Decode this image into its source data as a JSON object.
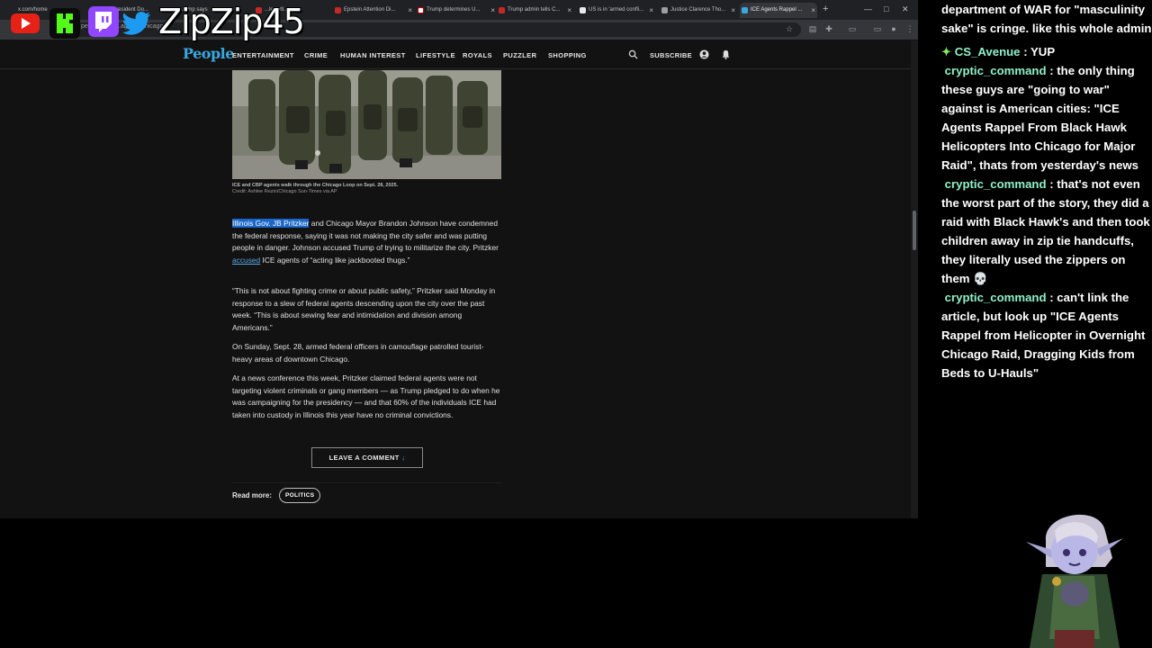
{
  "overlay": {
    "streamer_name": "ZipZip45",
    "badges": [
      "youtube-icon",
      "kick-icon",
      "twitch-icon",
      "twitter-icon"
    ]
  },
  "browser": {
    "tabs": [
      {
        "label": "x.com/home"
      },
      {
        "label": "Vice President Do..."
      },
      {
        "label": "...ump says"
      },
      {
        "label": "...legedl..."
      },
      {
        "label": "Epstein Attention Di..."
      },
      {
        "label": "Trump determines U..."
      },
      {
        "label": "Trump admin tells C..."
      },
      {
        "label": "US is in 'armed confli..."
      },
      {
        "label": "Justice Clarence Tho..."
      },
      {
        "label": "ICE Agents Rappel ..."
      }
    ],
    "url": "people.com/...agents-chicago..."
  },
  "site": {
    "logo": "People",
    "nav": [
      "ENTERTAINMENT",
      "CRIME",
      "HUMAN INTEREST",
      "LIFESTYLE",
      "ROYALS",
      "PUZZLER",
      "SHOPPING"
    ],
    "subscribe": "SUBSCRIBE"
  },
  "article": {
    "caption": "ICE and CBP agents walk through the Chicago Loop on Sept. 28, 2025.",
    "credit": "Credit: Ashlee Rezin/Chicago Sun-Times via AP",
    "p1_hl": "Illinois Gov. JB Pritzker",
    "p1_a": " and Chicago Mayor Brandon Johnson have condemned the federal response, saying it was not making the city safer and was putting people in danger. Johnson accused Trump of trying to militarize the city. Pritzker ",
    "p1_link": "accused",
    "p1_b": " ICE agents of “acting like jackbooted thugs.”",
    "p2": "“This is not about fighting crime or about public safety,” Pritzker said Monday in response to a slew of federal agents descending upon the city over the past week. “This is about sewing fear and intimidation and division among Americans.”",
    "p3": "On Sunday, Sept. 28, armed federal officers in camouflage patrolled tourist-heavy areas of downtown Chicago.",
    "p4": "At a news conference this week, Pritzker claimed federal agents were not targeting violent criminals or gang members — as Trump pledged to do when he was campaigning for the presidency — and that 60% of the individuals ICE had taken into custody in Illinois this year have no criminal convictions.",
    "comment_button": "LEAVE A COMMENT",
    "read_more_label": "Read more:",
    "read_more_tag": "POLITICS"
  },
  "chat": {
    "first_line": "department of WAR for \"masculinity sake\" is cringe. like this whole admin",
    "messages": [
      {
        "user": "CS_Avenue",
        "text": "YUP",
        "badge": "star-icon"
      },
      {
        "user": "cryptic_command",
        "text": "the only thing these guys are \"going to war\" against is American cities: \"ICE Agents Rappel From Black Hawk Helicopters Into Chicago for Major Raid\", thats from yesterday's news"
      },
      {
        "user": "cryptic_command",
        "text": "that's not even the worst part of the story, they did a raid with Black Hawk's and then took children away in zip tie handcuffs, they literally used the zippers on them 💀"
      },
      {
        "user": "cryptic_command",
        "text": "can't link the article, but look up \"ICE Agents Rappel from Helicopter in Overnight Chicago Raid, Dragging Kids from Beds to U-Hauls\""
      }
    ]
  },
  "colors": {
    "people_blue": "#3aa8e0",
    "chat_user": "#8ff0c7",
    "selection": "#1a66c9"
  }
}
